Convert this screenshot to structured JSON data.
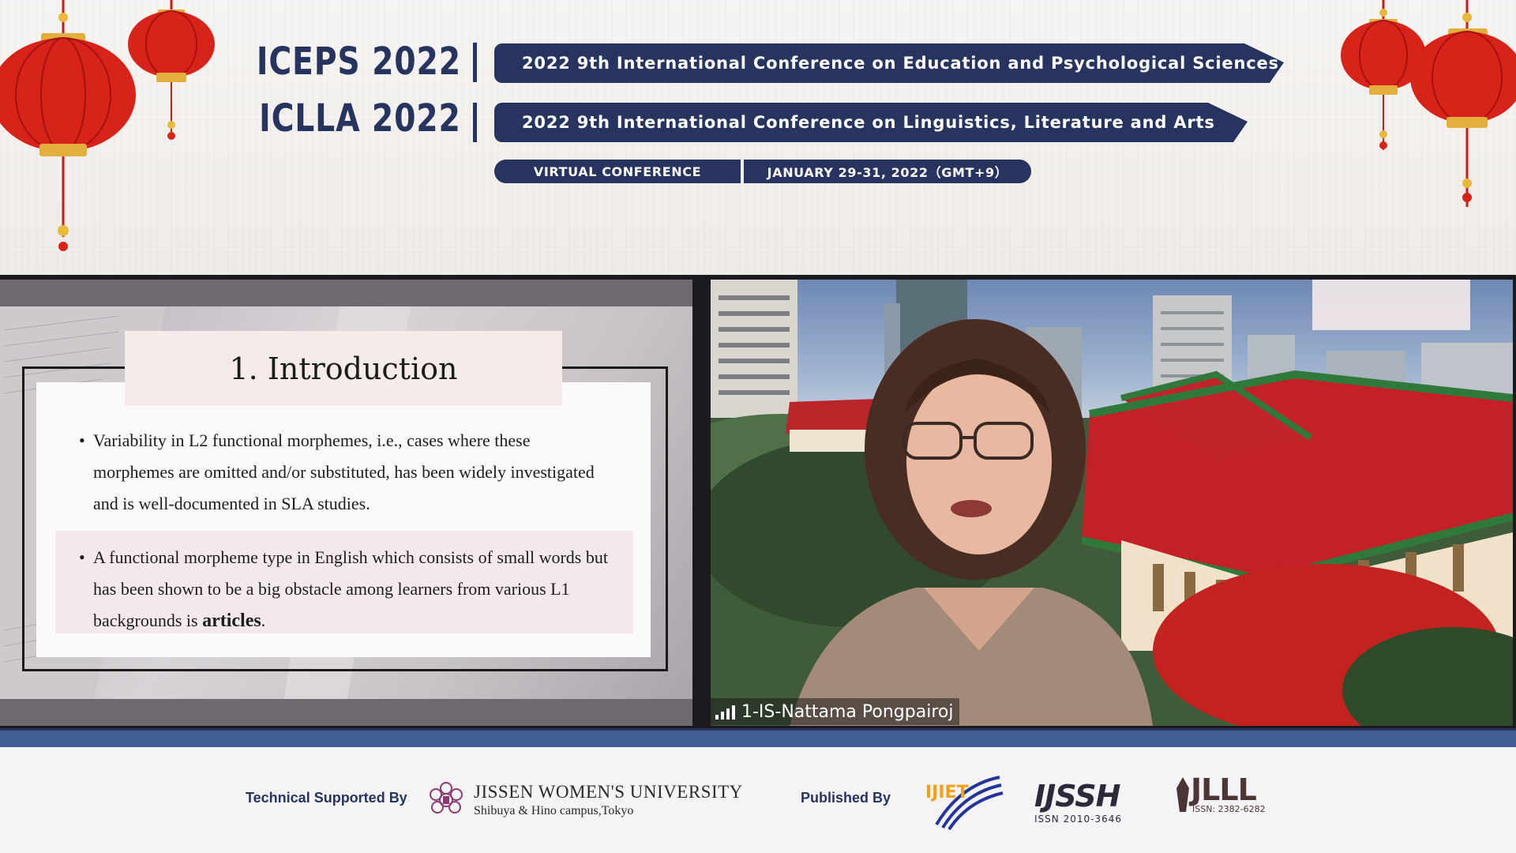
{
  "header": {
    "conferences": [
      {
        "acronym": "ICEPS 2022",
        "title": "2022 9th International Conference on Education and Psychological Sciences"
      },
      {
        "acronym": "ICLLA 2022",
        "title": "2022 9th International Conference on Linguistics, Literature and Arts"
      }
    ],
    "format": "VIRTUAL CONFERENCE",
    "dates": "JANUARY 29-31, 2022（GMT+9）"
  },
  "slide": {
    "title": "1. Introduction",
    "bullets": [
      "Variability in L2 functional morphemes, i.e., cases where these morphemes are omitted and/or substituted, has been widely investigated and is well-documented in SLA studies.",
      "A functional morpheme type in English which consists of small words but has been shown to be a big obstacle among learners from various L1 backgrounds is"
    ],
    "bullet2_emphasis": "articles",
    "bullet2_end": "."
  },
  "participant": {
    "name": "1-IS-Nattama Pongpairoj"
  },
  "footer": {
    "technical_label": "Technical Supported By",
    "university_name": "JISSEN WOMEN'S UNIVERSITY",
    "university_sub": "Shibuya & Hino campus,Tokyo",
    "published_label": "Published By",
    "journals": [
      {
        "name": "IJIET"
      },
      {
        "name": "IJSSH",
        "issn": "ISSN 2010-3646"
      },
      {
        "name": "IJLLL",
        "issn": "ISSN: 2382-6282"
      }
    ]
  },
  "colors": {
    "navy": "#26345f",
    "lantern_red": "#d8231a",
    "gold": "#e0b043"
  }
}
